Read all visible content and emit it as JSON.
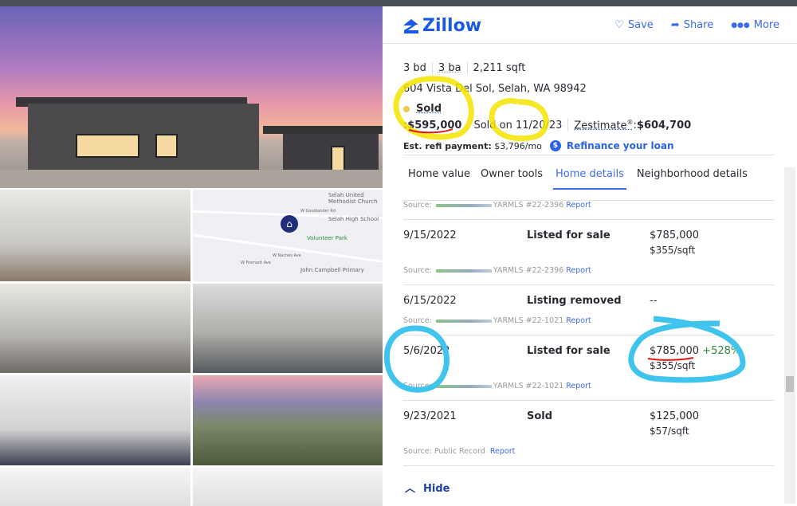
{
  "header": {
    "brand": "Zillow",
    "actions": [
      {
        "icon": "heart-icon",
        "label": "Save"
      },
      {
        "icon": "share-icon",
        "label": "Share"
      },
      {
        "icon": "more-icon",
        "label": "More"
      }
    ]
  },
  "property": {
    "beds": "3 bd",
    "baths": "3 ba",
    "sqft": "2,211 sqft",
    "address": "604 Vista Del Sol, Selah, WA 98942",
    "status": "Sold",
    "status_color": "#f1c84b",
    "price_prefix": ": ",
    "price": "$595,000",
    "sold_on": "Sold on 11/20/23",
    "zestimate_label": "Zestimate",
    "zestimate_mark": "®",
    "zestimate_sep": ": ",
    "zestimate": "$604,700",
    "refi_label": "Est. refi payment:",
    "refi_value": "$3,796/mo",
    "refi_icon": "$",
    "refi_link": "Refinance your loan"
  },
  "tabs": [
    {
      "label": "Home value"
    },
    {
      "label": "Owner tools"
    },
    {
      "label": "Home details",
      "active": true
    },
    {
      "label": "Neighborhood details"
    }
  ],
  "history": {
    "top_source": {
      "label": "Source:",
      "mls": "YARMLS #22-2396",
      "report": "Report"
    },
    "rows": [
      {
        "date": "9/15/2022",
        "event": "Listed for sale",
        "price": "$785,000",
        "per_sqft": "$355/sqft",
        "source": "Source:",
        "mls": "YARMLS #22-2396",
        "report": "Report"
      },
      {
        "date": "6/15/2022",
        "event": "Listing removed",
        "price": "--",
        "per_sqft": "",
        "source": "Source:",
        "mls": "YARMLS #22-1021",
        "report": "Report"
      },
      {
        "date": "5/6/2022",
        "event": "Listed for sale",
        "price": "$785,000",
        "change": "+528%",
        "per_sqft": "$355/sqft",
        "source": "Source:",
        "mls": "YARMLS #22-1021",
        "report": "Report"
      },
      {
        "date": "9/23/2021",
        "event": "Sold",
        "price": "$125,000",
        "per_sqft": "$57/sqft",
        "source": "Source: Public Record",
        "mls": "",
        "report": "Report"
      }
    ],
    "hide_label": "Hide"
  },
  "map": {
    "labels": [
      "Selah United Methodist Church",
      "Selah High School",
      "Volunteer Park",
      "John Campbell Primary",
      "W Goodlander Rd",
      "W Fremont Ave",
      "W Naches Ave"
    ]
  },
  "colors": {
    "accent": "#3d6bf0",
    "brand": "#1a58e8",
    "positive": "#2e8b3a",
    "annotation_yellow": "#f5e400",
    "annotation_blue": "#3fc4ee",
    "annotation_red": "#e01818"
  }
}
